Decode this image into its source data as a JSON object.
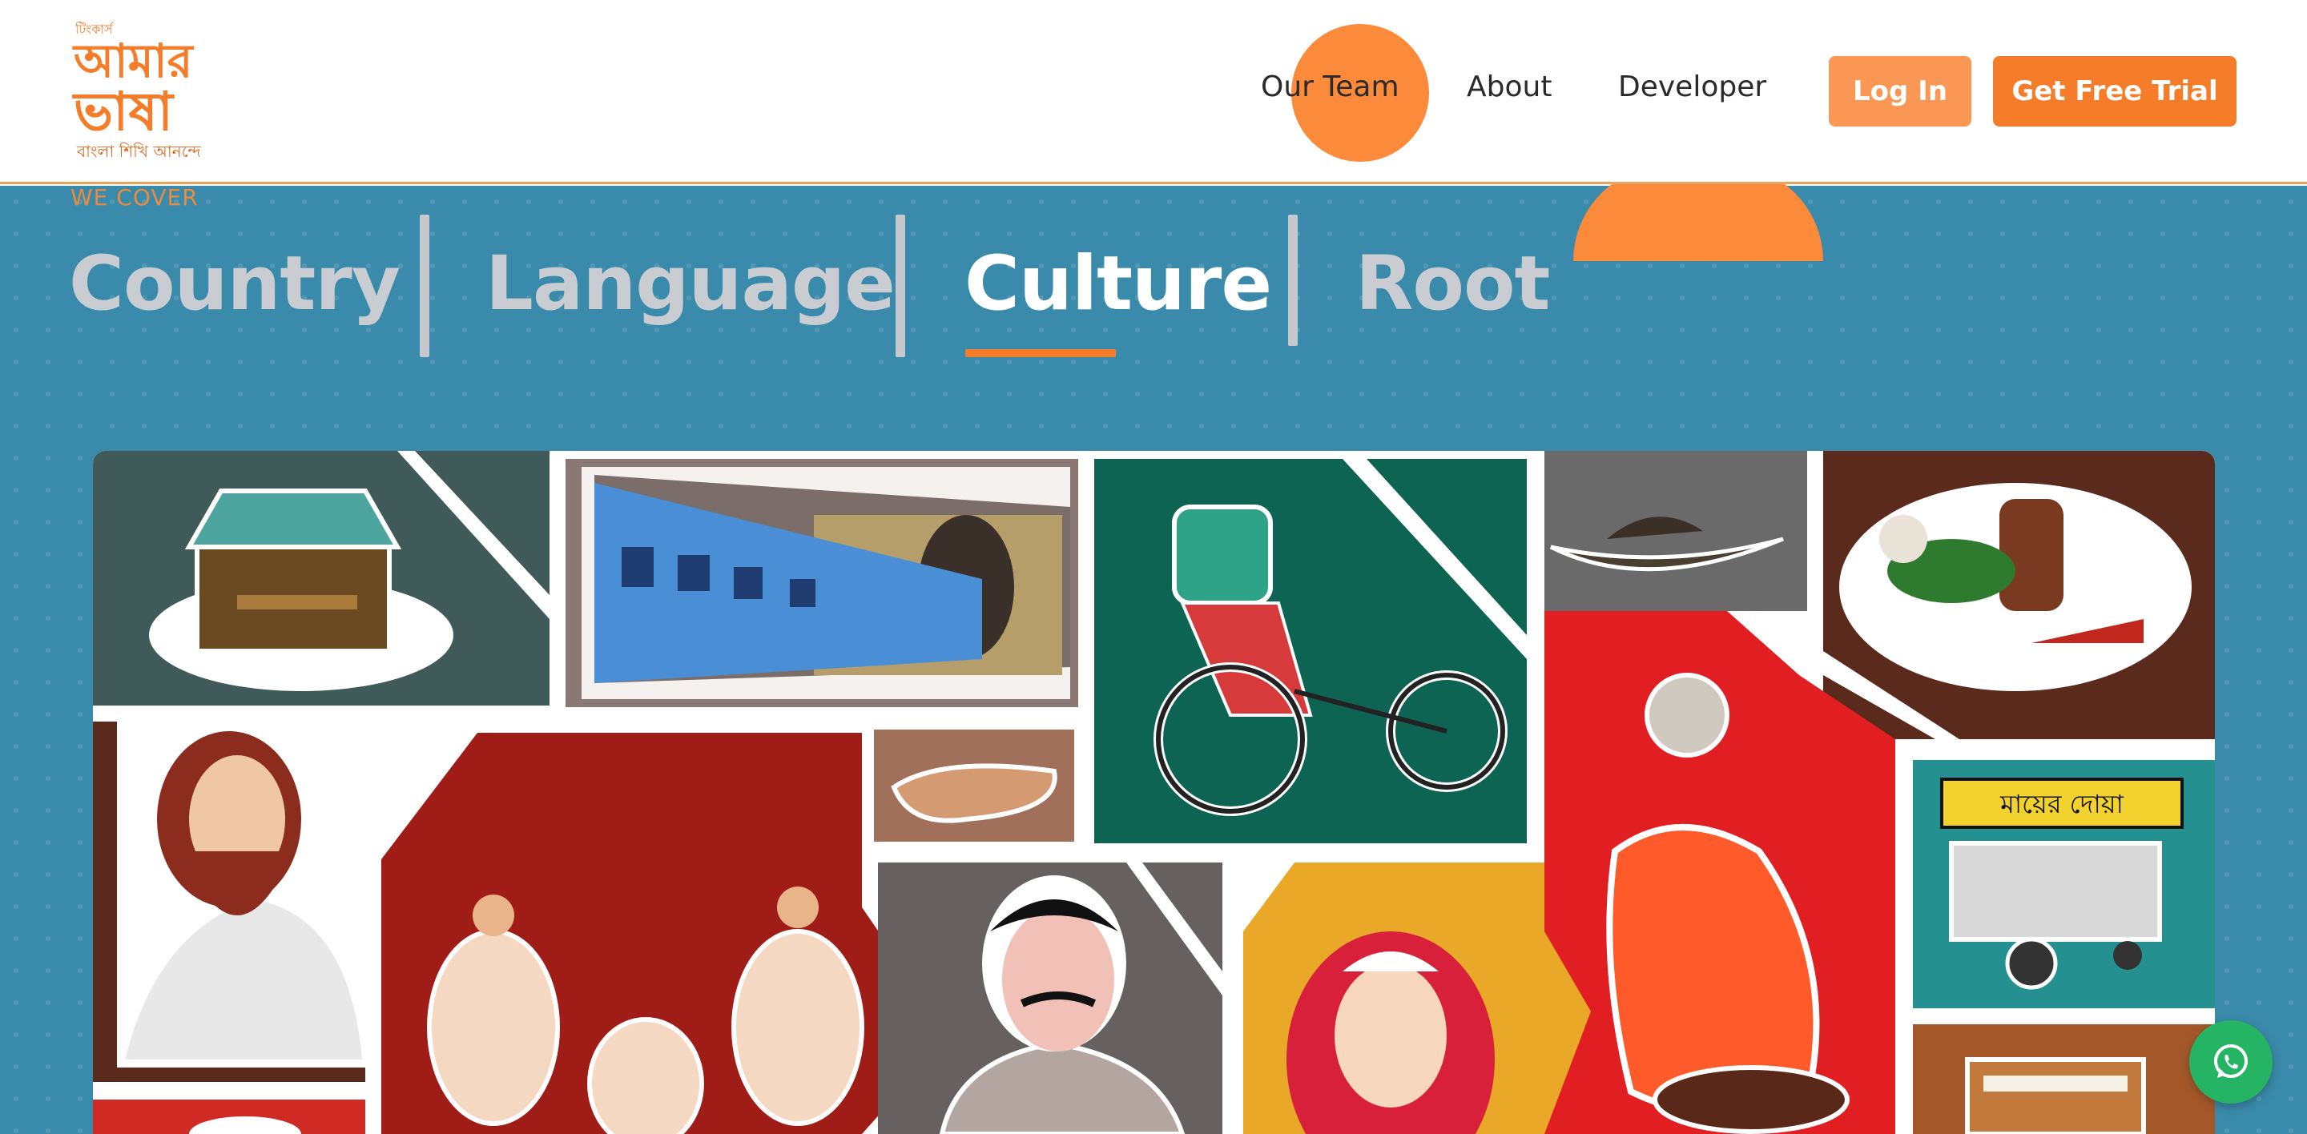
{
  "header": {
    "logo": {
      "top_text": "টিংকার্স",
      "line1": "আমার",
      "line2": "ভাষা",
      "tagline": "বাংলা শিখি আনন্দে"
    },
    "nav": [
      {
        "label": "Our Team"
      },
      {
        "label": "About"
      },
      {
        "label": "Developer"
      }
    ],
    "login_label": "Log In",
    "trial_label": "Get Free Trial"
  },
  "banner": {
    "eyebrow": "WE COVER",
    "topics": [
      {
        "label": "Country",
        "active": false
      },
      {
        "label": "Language",
        "active": false
      },
      {
        "label": "Culture",
        "active": true
      },
      {
        "label": "Root",
        "active": false
      }
    ]
  },
  "collage": {
    "sign_text": "মায়ের দোয়া"
  },
  "colors": {
    "accent": "#f57d2a",
    "banner_bg": "#3a8aab",
    "whatsapp": "#25b463"
  },
  "icons": {
    "whatsapp": "whatsapp-icon"
  }
}
